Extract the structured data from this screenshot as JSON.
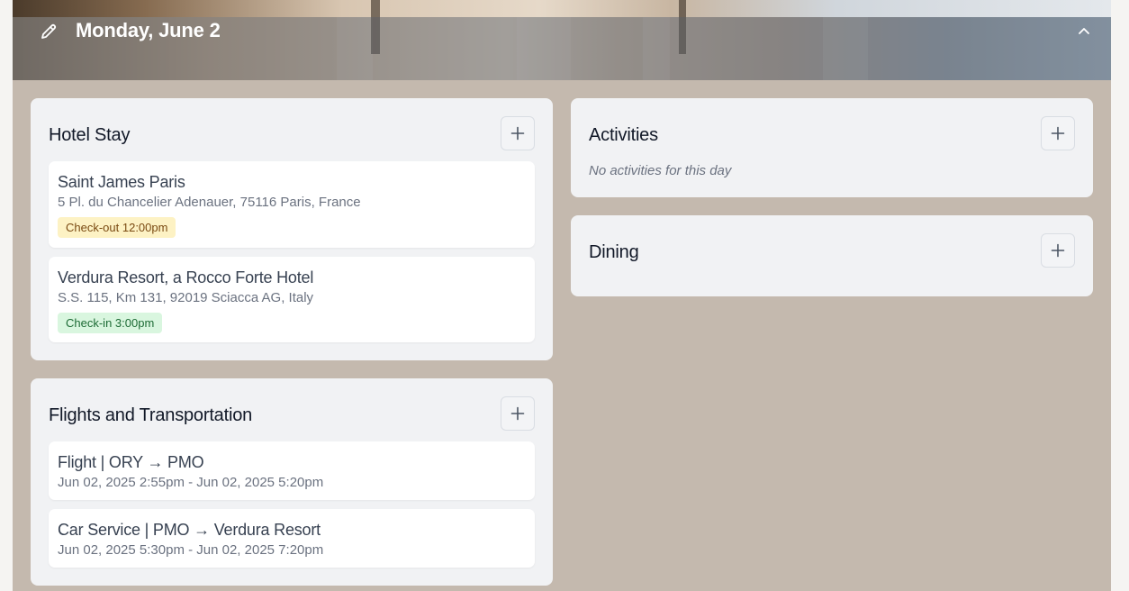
{
  "day": {
    "title": "Monday, June 2",
    "icons": {
      "edit": "pencil-icon",
      "collapse": "chevron-up-icon",
      "add": "plus-icon"
    }
  },
  "hotel": {
    "title": "Hotel Stay",
    "items": [
      {
        "name": "Saint James Paris",
        "address": "5 Pl. du Chancelier Adenauer, 75116 Paris, France",
        "badge": "Check-out 12:00pm"
      },
      {
        "name": "Verdura Resort, a Rocco Forte Hotel",
        "address": "S.S. 115, Km 131, 92019 Sciacca AG, Italy",
        "badge": "Check-in 3:00pm"
      }
    ]
  },
  "flights": {
    "title": "Flights and Transportation",
    "items": [
      {
        "title": "Flight | ORY → PMO",
        "time": "Jun 02, 2025 2:55pm - Jun 02, 2025 5:20pm"
      },
      {
        "title": "Car Service | PMO → Verdura Resort",
        "time": "Jun 02, 2025 5:30pm - Jun 02, 2025 7:20pm"
      }
    ]
  },
  "activities": {
    "title": "Activities",
    "empty": "No activities for this day"
  },
  "dining": {
    "title": "Dining"
  },
  "colors": {
    "day_background": "#c4b9ae",
    "card_background": "#f1f2f4",
    "checkout_badge": "#fdf2c4",
    "checkin_badge": "#d9f6df"
  }
}
